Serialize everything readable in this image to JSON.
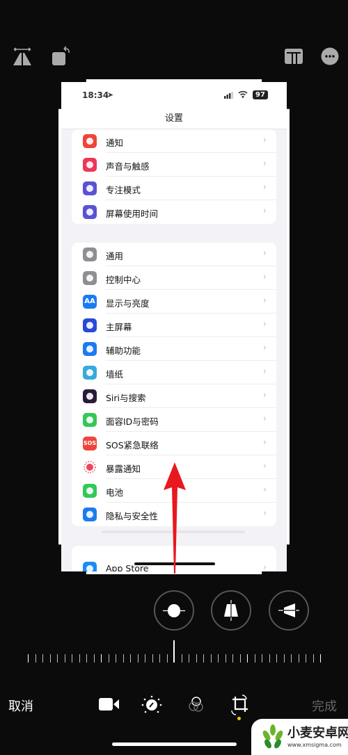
{
  "toolbar": {
    "top_left": [
      "flip-horizontal-icon",
      "rotate-icon"
    ],
    "top_right": [
      "aspect-ratio-icon",
      "more-icon"
    ]
  },
  "screenshot": {
    "status": {
      "time": "18:34",
      "battery": "97"
    },
    "title": "设置",
    "groups": [
      [
        {
          "label": "通知",
          "icon": "notification-icon",
          "color": "#f0443a"
        },
        {
          "label": "声音与触感",
          "icon": "sound-icon",
          "color": "#ee3656"
        },
        {
          "label": "专注模式",
          "icon": "moon-icon",
          "color": "#5a52d6"
        },
        {
          "label": "屏幕使用时间",
          "icon": "hourglass-icon",
          "color": "#5a52d6"
        }
      ],
      [
        {
          "label": "通用",
          "icon": "gear-icon",
          "color": "#8e8e93"
        },
        {
          "label": "控制中心",
          "icon": "toggle-icon",
          "color": "#8e8e93"
        },
        {
          "label": "显示与亮度",
          "icon": "text-size-icon",
          "color": "#1a7cf2",
          "glyph": "AA"
        },
        {
          "label": "主屏幕",
          "icon": "home-grid-icon",
          "color": "#2a48d8"
        },
        {
          "label": "辅助功能",
          "icon": "accessibility-icon",
          "color": "#1a7cf2"
        },
        {
          "label": "墙纸",
          "icon": "wallpaper-icon",
          "color": "#36aadc"
        },
        {
          "label": "Siri与搜索",
          "icon": "siri-icon",
          "color": "#2a1a3a"
        },
        {
          "label": "面容ID与密码",
          "icon": "face-id-icon",
          "color": "#34c759"
        },
        {
          "label": "SOS紧急联络",
          "icon": "sos-icon",
          "color": "#f0443a",
          "glyph": "SOS"
        },
        {
          "label": "暴露通知",
          "icon": "exposure-icon",
          "color": "#ffffff"
        },
        {
          "label": "电池",
          "icon": "battery-icon",
          "color": "#34c759"
        },
        {
          "label": "隐私与安全性",
          "icon": "hand-icon",
          "color": "#1a7cf2"
        }
      ],
      [
        {
          "label": "App Store",
          "icon": "app-store-icon",
          "color": "#1a8cf5"
        }
      ]
    ]
  },
  "perspective_buttons": [
    "straighten-icon",
    "vertical-perspective-icon",
    "horizontal-perspective-icon"
  ],
  "bottom": {
    "cancel": "取消",
    "done": "完成",
    "tools": [
      "live-video-icon",
      "adjust-icon",
      "filters-icon",
      "crop-rotate-icon"
    ]
  },
  "colors": {
    "arrow": "#e8181e",
    "active_dot": "#f5c518"
  },
  "watermark": {
    "text": "小麦安卓网",
    "url": "www.xmsigma.com"
  }
}
